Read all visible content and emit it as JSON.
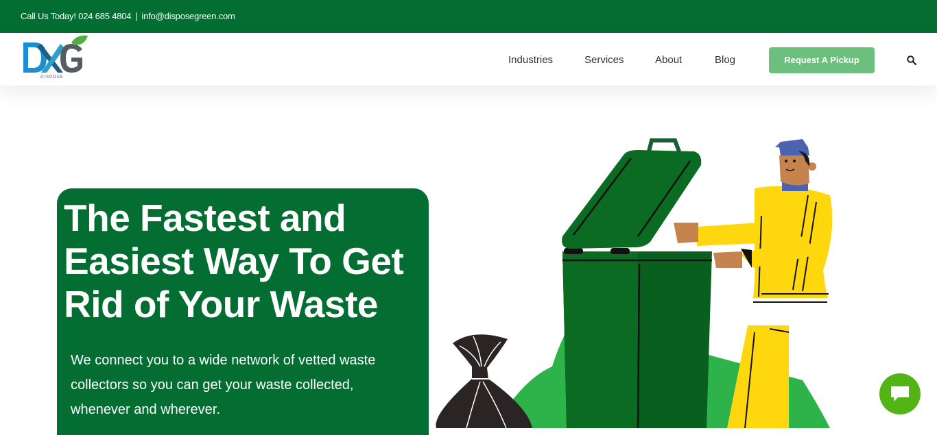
{
  "topbar": {
    "phone_text": "Call Us Today! 024 685 4804",
    "separator": "|",
    "email_text": "info@disposegreen.com"
  },
  "header": {
    "logo_sub": "DISPOSE",
    "nav": [
      {
        "label": "Industries"
      },
      {
        "label": "Services"
      },
      {
        "label": "About"
      },
      {
        "label": "Blog"
      }
    ],
    "cta_label": "Request A Pickup",
    "search_icon": "search-icon"
  },
  "hero": {
    "title": "The Fastest and Easiest Way To Get Rid of Your Waste",
    "subtitle": "We connect you to a wide network of vetted waste collectors so you can get your waste collected, whenever and wherever."
  },
  "chat": {
    "icon": "chat-bubble-icon"
  },
  "colors": {
    "brand_green": "#036d32",
    "cta_green": "#6cbf7d",
    "chat_green": "#52b417",
    "worker_yellow": "#ffd70f",
    "bin_green": "#0b6b22"
  }
}
